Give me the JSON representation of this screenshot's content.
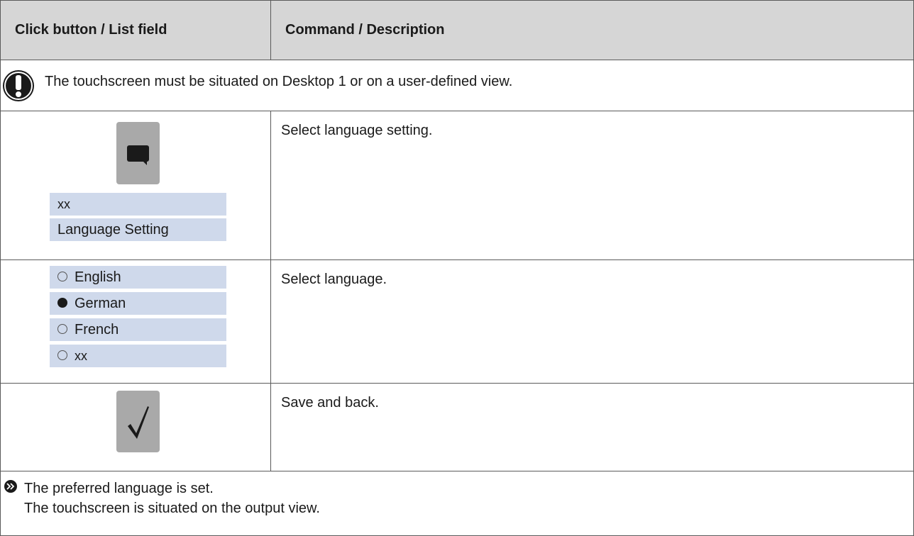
{
  "header": {
    "col1": "Click button / List field",
    "col2": "Command / Description"
  },
  "note": {
    "icon": "exclamation-icon",
    "text": "The touchscreen must be situated on Desktop 1 or on a user-defined view."
  },
  "steps": {
    "language_setting": {
      "icon": "speech-bubble-icon",
      "list": [
        "xx",
        "Language Setting"
      ],
      "description": "Select language setting."
    },
    "language_list": {
      "options": [
        {
          "label": "English",
          "selected": false
        },
        {
          "label": "German",
          "selected": true
        },
        {
          "label": "French",
          "selected": false
        },
        {
          "label": "xx",
          "selected": false
        }
      ],
      "description": "Select language."
    },
    "save": {
      "icon": "checkmark-icon",
      "glyph": "√",
      "description": "Save and back."
    }
  },
  "result": {
    "icon": "result-arrow-icon",
    "line1": "The preferred language is set.",
    "line2": "The touchscreen is situated on the output view."
  },
  "colors": {
    "header_bg": "#d6d6d6",
    "list_bg": "#cfd9eb",
    "button_bg": "#a9a9a9",
    "border": "#5a5a5a"
  }
}
